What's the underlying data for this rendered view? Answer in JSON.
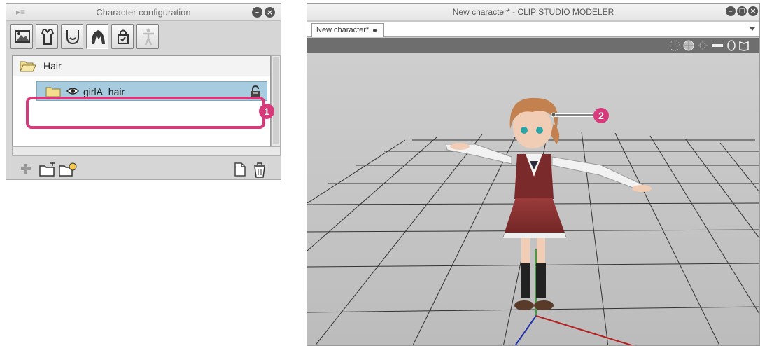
{
  "config_panel": {
    "title": "Character configuration",
    "tabs": [
      "scene-icon",
      "shirt-icon",
      "face-icon",
      "hair-icon",
      "accessory-icon",
      "pose-figure-icon"
    ],
    "active_tab_index": 3,
    "groups": [
      {
        "label": "Hair",
        "items": [
          {
            "label": "girlA_hair",
            "visible": true,
            "selected": true
          }
        ]
      }
    ]
  },
  "modeler": {
    "window_title": "New character* - CLIP STUDIO MODELER",
    "document_tab": "New character*"
  },
  "callouts": [
    "1",
    "2"
  ],
  "colors": {
    "callout": "#d63a7a",
    "selection": "#a8ccdf",
    "viewport_bg": "#c6c6c6"
  }
}
